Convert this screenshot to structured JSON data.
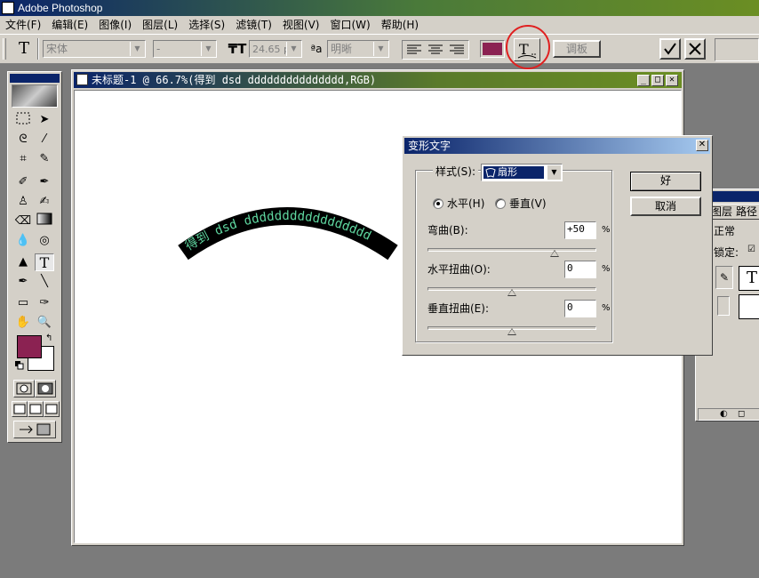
{
  "app": {
    "title": "Adobe Photoshop"
  },
  "menu": [
    "文件(F)",
    "编辑(E)",
    "图像(I)",
    "图层(L)",
    "选择(S)",
    "滤镜(T)",
    "视图(V)",
    "窗口(W)",
    "帮助(H)"
  ],
  "options": {
    "font_family": "宋体",
    "font_style": "-",
    "font_size": "24.65 p",
    "antialias": "明晰",
    "palettes_label": "调板",
    "text_color": "#8b2252"
  },
  "document": {
    "title": "未标题-1 @ 66.7%(得到 dsd ddddddddddddddd,RGB)",
    "warped_text": "得到 dsd ddddddddddddddddd",
    "text_fill": "#5fd7a0"
  },
  "layers_panel": {
    "tab1": "图层",
    "tab2": "路径",
    "mode": "正常",
    "lock": "锁定:"
  },
  "dialog": {
    "title": "变形文字",
    "style_label": "样式(S):",
    "style_value": "扇形",
    "horizontal": "水平(H)",
    "vertical": "垂直(V)",
    "bend_label": "弯曲(B):",
    "bend_value": "+50",
    "hdist_label": "水平扭曲(O):",
    "hdist_value": "0",
    "vdist_label": "垂直扭曲(E):",
    "vdist_value": "0",
    "percent": "%",
    "ok": "好",
    "cancel": "取消",
    "bend_level": 0.75,
    "hdist_level": 0.5,
    "vdist_level": 0.5
  },
  "toolbox": {
    "fg_color": "#8b2252",
    "bg_color": "#ffffff"
  }
}
